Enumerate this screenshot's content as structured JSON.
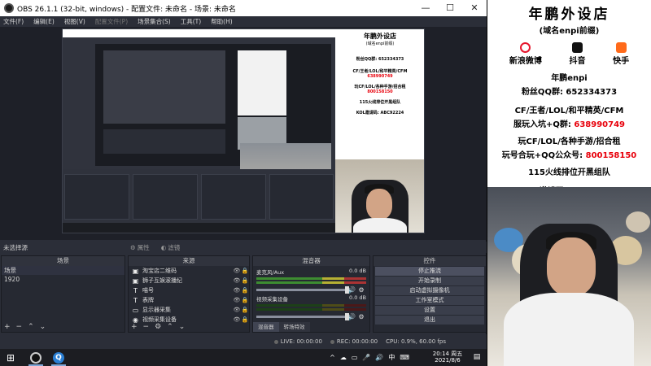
{
  "window": {
    "title": "OBS 26.1.1 (32-bit, windows) - 配置文件: 未命名 - 场景: 未命名",
    "minimize": "—",
    "maximize": "☐",
    "close": "✕"
  },
  "menu": [
    "文件(F)",
    "编辑(E)",
    "视图(V)",
    "配置文件(P)",
    "场景集合(S)",
    "工具(T)",
    "帮助(H)"
  ],
  "dock_bar": {
    "no_source": "未选择源",
    "properties": "属性",
    "filters": "滤镜"
  },
  "scenes": {
    "title": "场景",
    "items": [
      "场景",
      "1920"
    ],
    "selected": 0
  },
  "sources": {
    "title": "来源",
    "items": [
      {
        "name": "淘宝店二维码",
        "icon": "image-icon"
      },
      {
        "name": "狮子互娱滚播纪",
        "icon": "image-icon"
      },
      {
        "name": "喵号",
        "icon": "text-icon"
      },
      {
        "name": "表牌",
        "icon": "text-icon"
      },
      {
        "name": "显示器采集",
        "icon": "monitor-icon"
      },
      {
        "name": "视频采集设备",
        "icon": "camera-icon"
      }
    ]
  },
  "mixer": {
    "title": "混音器",
    "tracks": [
      {
        "name": "麦克风/Aux",
        "db": "0.0 dB"
      },
      {
        "name": "视频采集设备",
        "db": "0.0 dB"
      }
    ],
    "tabs": [
      "混音器",
      "转场特效"
    ]
  },
  "controls": {
    "title": "控件",
    "buttons": [
      "停止推流",
      "开始录制",
      "启动虚拟摄像机",
      "工作室模式",
      "设置",
      "退出"
    ]
  },
  "status": {
    "live": "LIVE: 00:00:00",
    "rec": "REC: 00:00:00",
    "cpu": "CPU: 0.9%, 60.00 fps"
  },
  "taskbar": {
    "tray": [
      "^",
      "☁",
      "▭",
      "🎤",
      "🔊",
      "中",
      "⌨"
    ],
    "time": "20:14 周五",
    "date": "2021/8/6"
  },
  "overlay": {
    "shop": "年鹏外设店",
    "domain": "(域名enpi前缀)",
    "socials": [
      "新浪微博",
      "抖音",
      "快手"
    ],
    "username": "年鹏enpi",
    "fans_qq": "粉丝QQ群: 652334373",
    "line1": "CF/王者/LOL/和平精英/CFM",
    "line2_prefix": "服玩入坑+Q群: ",
    "line2_value": "638990749",
    "line3": "玩CF/LOL/各种手游/招合租",
    "line4_prefix": "玩号合玩+QQ公众号: ",
    "line4_value": "800158150",
    "line5": "115火线排位开黑组队",
    "line6": "KOL邀请码: ABC92224"
  },
  "colors": {
    "obs_bg": "#2b2e38",
    "dock_bg": "#262932",
    "overlay_red": "#e8000b"
  }
}
